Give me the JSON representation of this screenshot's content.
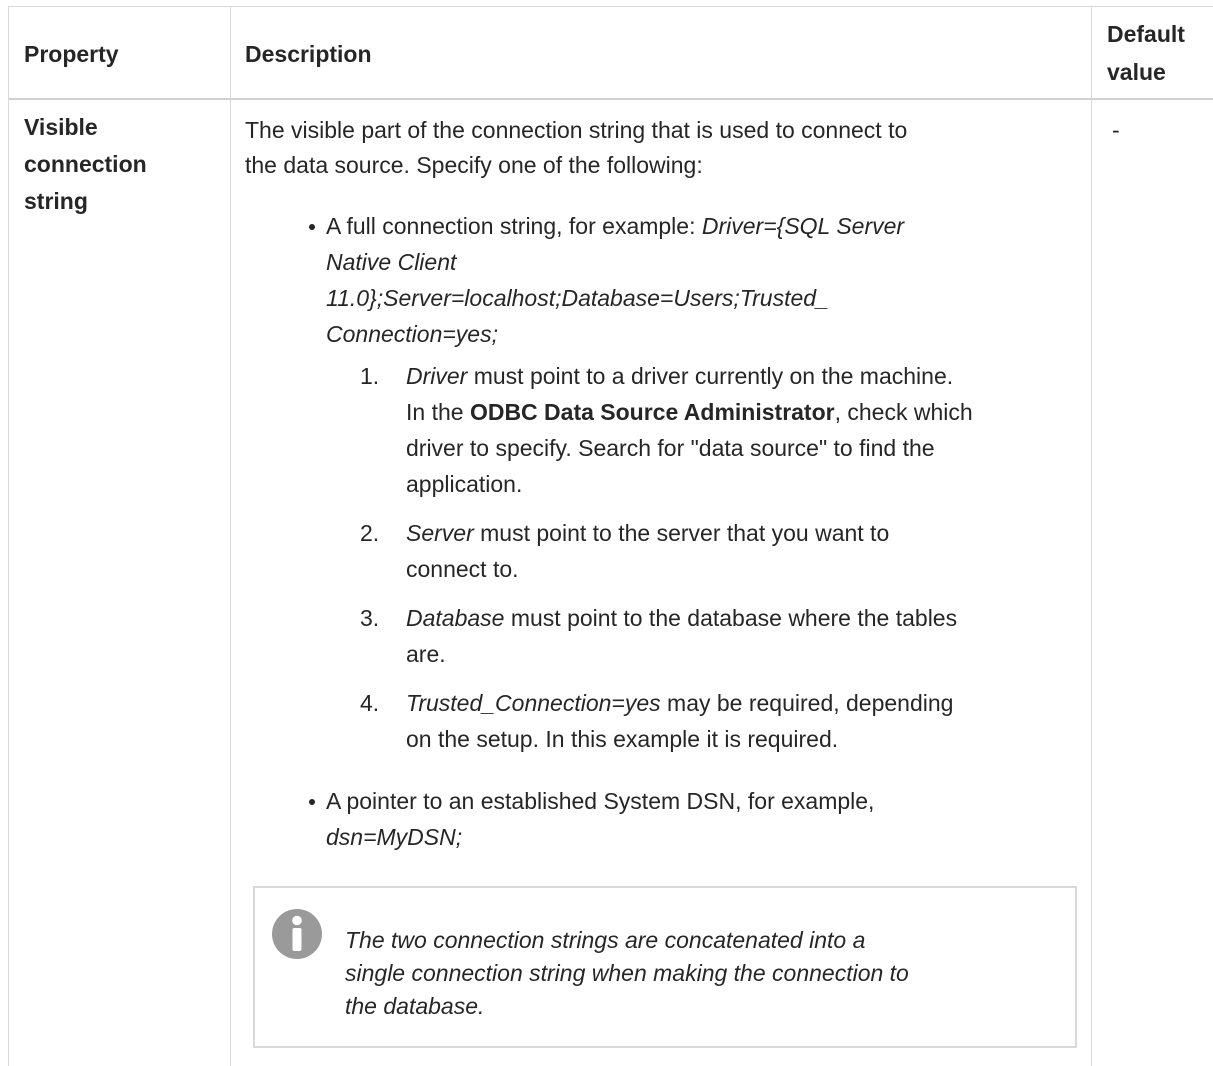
{
  "table": {
    "headers": {
      "property": "Property",
      "description": "Description",
      "default_line1": "Default",
      "default_line2": "value"
    },
    "row": {
      "property_line1": "Visible",
      "property_line2": "connection",
      "property_line3": "string",
      "default_value": "-",
      "intro_line1": "The visible part of the connection string that is used to connect to",
      "intro_line2": "the data source. Specify one of the following:",
      "bullet1": {
        "line1_prefix": "A full connection string, for example: ",
        "line1_italic": "Driver={SQL Server",
        "line2": "Native Client",
        "line3": "11.0};Server=localhost;Database=Users;Trusted_",
        "line4": "Connection=yes;"
      },
      "steps": [
        {
          "number": "1.",
          "l1_italic": "Driver",
          "l1_rest": " must point to a driver currently on the machine.",
          "l2_prefix": "In the ",
          "l2_bold": "ODBC Data Source Administrator",
          "l2_rest": ", check which",
          "l3": "driver to specify. Search for \"data source\" to find the",
          "l4": "application."
        },
        {
          "number": "2.",
          "l1_italic": "Server",
          "l1_rest": " must point to the server that you want to",
          "l2": "connect to."
        },
        {
          "number": "3.",
          "l1_italic": "Database",
          "l1_rest": " must point to the database where the tables",
          "l2": "are."
        },
        {
          "number": "4.",
          "l1_italic": "Trusted_Connection=yes",
          "l1_rest": " may be required, depending",
          "l2": "on the setup. In this example it is required."
        }
      ],
      "bullet2": {
        "line1": "A pointer to an established System DSN, for example,",
        "line2_italic": "dsn=MyDSN;"
      },
      "note": {
        "icon": "info-icon",
        "line1": "The two connection strings are concatenated into a",
        "line2": "single connection string when making the connection to",
        "line3": "the database."
      }
    }
  }
}
